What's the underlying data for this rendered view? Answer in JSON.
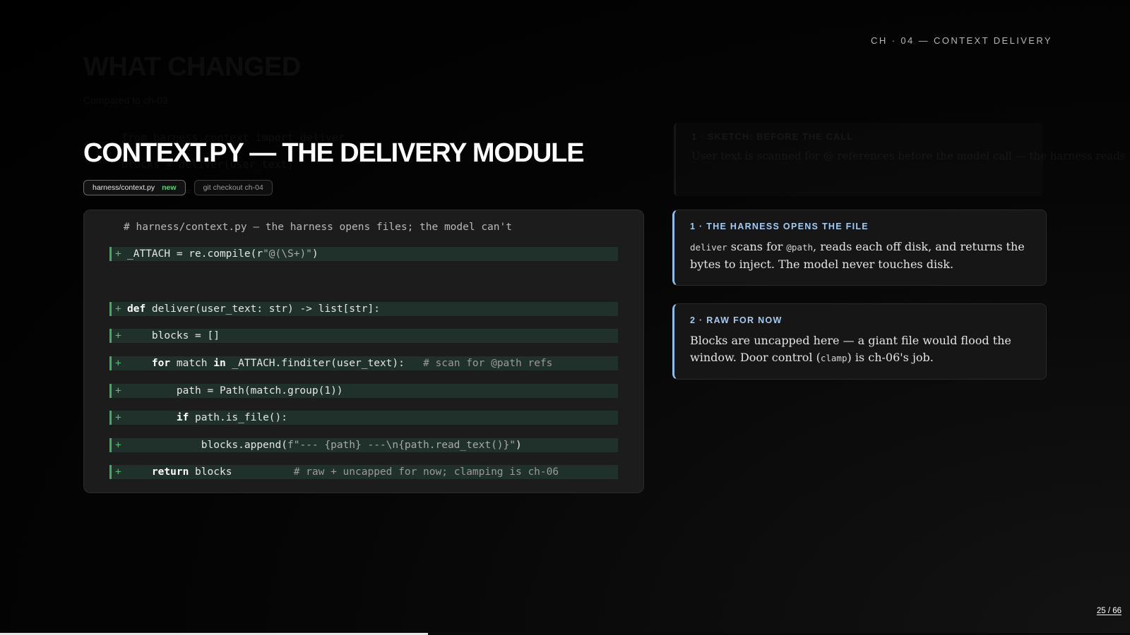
{
  "header": {
    "chapter_label": "CH · 04 — CONTEXT DELIVERY"
  },
  "ghost": {
    "heading": "WHAT CHANGED",
    "sub": "Compared to ch-03",
    "code_lines": [
      "from harness.context import deliver",
      "blocks = deliver(user_text)",
      "messages += blocks"
    ],
    "card_title": "1 · SKETCH: BEFORE THE CALL",
    "card_body": "User text is scanned for @ references before the model call — the harness reads the file."
  },
  "slide": {
    "title": "CONTEXT.PY — THE DELIVERY MODULE",
    "chips": {
      "file": "harness/context.py",
      "file_badge": "new",
      "checkout": "git checkout ch-04"
    }
  },
  "code": {
    "header_comment": "# harness/context.py — the harness opens files; the model can't",
    "lines": [
      {
        "marker": "+",
        "parts": [
          {
            "text": "_ATTACH = re.compile(r",
            "cls": ""
          },
          {
            "text": "\"@(\\S+)\"",
            "cls": "str"
          },
          {
            "text": ")",
            "cls": ""
          }
        ]
      },
      {
        "marker": "+",
        "parts": [
          {
            "text": "def",
            "cls": "kw"
          },
          {
            "text": " deliver(user_text: str) -> list[str]:",
            "cls": ""
          }
        ]
      },
      {
        "marker": "+",
        "parts": [
          {
            "text": "    blocks = []",
            "cls": ""
          }
        ]
      },
      {
        "marker": "+",
        "parts": [
          {
            "text": "    ",
            "cls": ""
          },
          {
            "text": "for",
            "cls": "kw"
          },
          {
            "text": " match ",
            "cls": ""
          },
          {
            "text": "in",
            "cls": "kw"
          },
          {
            "text": " _ATTACH.finditer(user_text):   ",
            "cls": ""
          },
          {
            "text": "# scan for @path refs",
            "cls": "cmt"
          }
        ]
      },
      {
        "marker": "+",
        "parts": [
          {
            "text": "        path = Path(match.group(1))",
            "cls": ""
          }
        ]
      },
      {
        "marker": "+",
        "parts": [
          {
            "text": "        ",
            "cls": ""
          },
          {
            "text": "if",
            "cls": "kw"
          },
          {
            "text": " path.is_file():",
            "cls": ""
          }
        ]
      },
      {
        "marker": "+",
        "parts": [
          {
            "text": "            blocks.append(",
            "cls": ""
          },
          {
            "text": "f\"--- {path} ---\\n{path.read_text()}\"",
            "cls": "str"
          },
          {
            "text": ")",
            "cls": ""
          }
        ]
      },
      {
        "marker": "+",
        "parts": [
          {
            "text": "    ",
            "cls": ""
          },
          {
            "text": "return",
            "cls": "kw"
          },
          {
            "text": " blocks          ",
            "cls": ""
          },
          {
            "text": "# raw + uncapped for now; clamping is ch-06",
            "cls": "cmt"
          }
        ]
      }
    ]
  },
  "cards": [
    {
      "label": "1 · THE HARNESS OPENS THE FILE",
      "body": [
        {
          "text": "deliver",
          "code": true
        },
        {
          "text": " scans for ",
          "code": false
        },
        {
          "text": "@path",
          "code": true
        },
        {
          "text": ", reads each off disk, and returns the bytes to inject. The model never touches disk.",
          "code": false
        }
      ]
    },
    {
      "label": "2 · RAW FOR NOW",
      "body": [
        {
          "text": "Blocks are uncapped here — a giant file would flood the window. Door control (",
          "code": false
        },
        {
          "text": "clamp",
          "code": true
        },
        {
          "text": ") is ch-06's job.",
          "code": false
        }
      ]
    }
  ],
  "footer": {
    "page_current": "25",
    "page_total": "66",
    "page_label": "25 / 66",
    "progress_fraction": 0.3788
  }
}
